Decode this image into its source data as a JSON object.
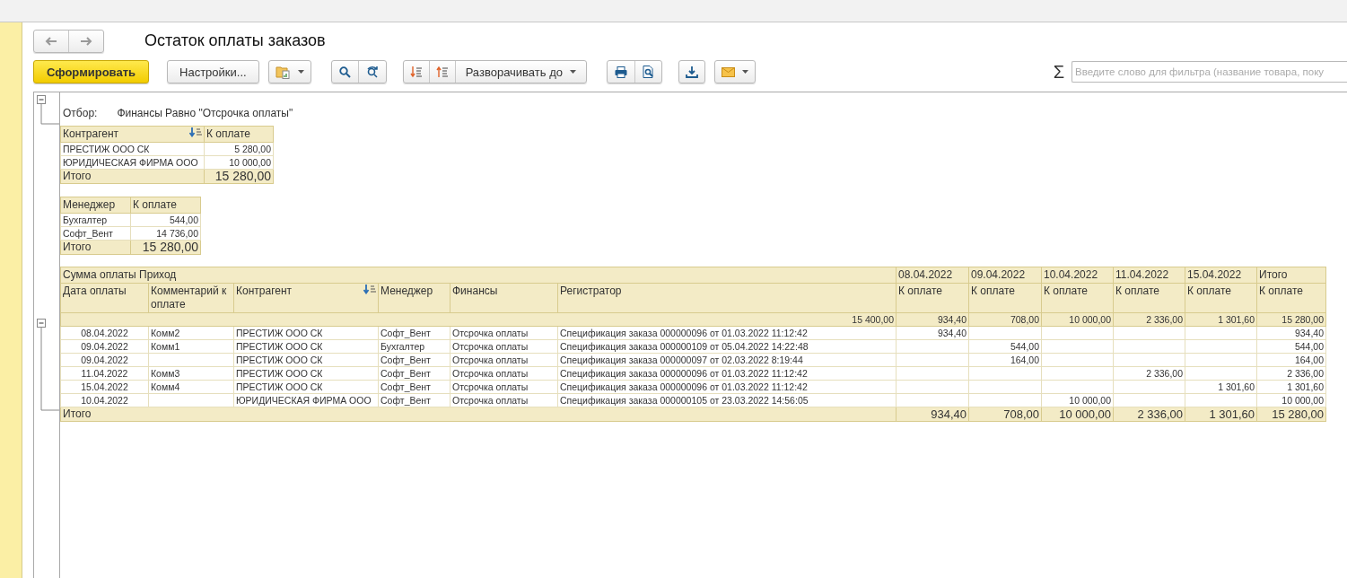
{
  "window": {
    "title": "Остаток оплаты заказов"
  },
  "navigation": [
    {
      "kind": "back",
      "disabled": true
    },
    {
      "kind": "forward",
      "disabled": true
    }
  ],
  "toolbar": [
    {
      "kind": "primary",
      "label": "Сформировать"
    },
    {
      "kind": "text",
      "label": "Настройки..."
    },
    {
      "kind": "variant-menu"
    },
    {
      "kind": "group",
      "items": [
        {
          "kind": "search"
        },
        {
          "kind": "search-refresh"
        }
      ]
    },
    {
      "kind": "group",
      "items": [
        {
          "kind": "sort-down"
        },
        {
          "kind": "sort-up"
        },
        {
          "kind": "dropdown",
          "label": "Разворачивать до"
        }
      ]
    },
    {
      "kind": "group",
      "items": [
        {
          "kind": "print"
        },
        {
          "kind": "preview"
        }
      ]
    },
    {
      "kind": "download"
    },
    {
      "kind": "mail-menu"
    }
  ],
  "sum_symbol": "Σ",
  "filter_field": {
    "placeholder": "Введите слово для фильтра (название товара, поку"
  },
  "report": {
    "filter": {
      "label": "Отбор:",
      "value": "Финансы Равно \"Отсрочка оплаты\""
    },
    "summary_tables": [
      {
        "columns": [
          {
            "label": "Контрагент",
            "sorted": true
          },
          {
            "label": "К оплате",
            "sorted": false
          }
        ],
        "rows": [
          [
            "ПРЕСТИЖ ООО СК",
            "5 280,00"
          ],
          [
            "ЮРИДИЧЕСКАЯ ФИРМА ООО",
            "10 000,00"
          ]
        ],
        "total": [
          "Итого",
          "15 280,00"
        ]
      },
      {
        "columns": [
          {
            "label": "Менеджер",
            "sorted": false
          },
          {
            "label": "К оплате",
            "sorted": false
          }
        ],
        "rows": [
          [
            "Бухгалтер",
            "544,00"
          ],
          [
            "Софт_Вент",
            "14 736,00"
          ]
        ],
        "total": [
          "Итого",
          "15 280,00"
        ]
      }
    ],
    "main_table": {
      "group_header": "Сумма оплаты Приход",
      "columns": [
        {
          "label": "Дата оплаты",
          "sorted": false
        },
        {
          "label": "Комментарий к оплате",
          "sorted": false
        },
        {
          "label": "Контрагент",
          "sorted": true
        },
        {
          "label": "Менеджер",
          "sorted": false
        },
        {
          "label": "Финансы",
          "sorted": false
        },
        {
          "label": "Регистратор",
          "sorted": false
        }
      ],
      "amount_columns": [
        {
          "period": "08.04.2022",
          "label": "К оплате"
        },
        {
          "period": "09.04.2022",
          "label": "К оплате"
        },
        {
          "period": "10.04.2022",
          "label": "К оплате"
        },
        {
          "period": "11.04.2022",
          "label": "К оплате"
        },
        {
          "period": "15.04.2022",
          "label": "К оплате"
        },
        {
          "period": "Итого",
          "label": "К оплате"
        }
      ],
      "group_row": {
        "amount": "15 400,00",
        "amounts": [
          "934,40",
          "708,00",
          "10 000,00",
          "2 336,00",
          "1 301,60",
          "15 280,00"
        ]
      },
      "rows": [
        {
          "date": "08.04.2022",
          "comment": "Комм2",
          "counterparty": "ПРЕСТИЖ ООО СК",
          "manager": "Софт_Вент",
          "finance": "Отсрочка оплаты",
          "registrar": "Спецификация заказа 000000096 от 01.03.2022 11:12:42",
          "amounts": {
            "column_1": "934,40"
          },
          "total": "934,40"
        },
        {
          "date": "09.04.2022",
          "comment": "Комм1",
          "counterparty": "ПРЕСТИЖ ООО СК",
          "manager": "Бухгалтер",
          "finance": "Отсрочка оплаты",
          "registrar": "Спецификация заказа 000000109 от 05.04.2022 14:22:48",
          "amounts": {
            "column_2": "544,00"
          },
          "total": "544,00"
        },
        {
          "date": "09.04.2022",
          "counterparty": "ПРЕСТИЖ ООО СК",
          "manager": "Софт_Вент",
          "finance": "Отсрочка оплаты",
          "registrar": "Спецификация заказа 000000097 от 02.03.2022 8:19:44",
          "amounts": {
            "column_2": "164,00"
          },
          "total": "164,00"
        },
        {
          "date": "11.04.2022",
          "comment": "Комм3",
          "counterparty": "ПРЕСТИЖ ООО СК",
          "manager": "Софт_Вент",
          "finance": "Отсрочка оплаты",
          "registrar": "Спецификация заказа 000000096 от 01.03.2022 11:12:42",
          "amounts": {
            "column_4": "2 336,00"
          },
          "total": "2 336,00"
        },
        {
          "date": "15.04.2022",
          "comment": "Комм4",
          "counterparty": "ПРЕСТИЖ ООО СК",
          "manager": "Софт_Вент",
          "finance": "Отсрочка оплаты",
          "registrar": "Спецификация заказа 000000096 от 01.03.2022 11:12:42",
          "amounts": {
            "column_5": "1 301,60"
          },
          "total": "1 301,60"
        },
        {
          "date": "10.04.2022",
          "counterparty": "ЮРИДИЧЕСКАЯ ФИРМА ООО",
          "manager": "Софт_Вент",
          "finance": "Отсрочка оплаты",
          "registrar": "Спецификация заказа 000000105 от 23.03.2022 14:56:05",
          "amounts": {
            "column_3": "10 000,00"
          },
          "total": "10 000,00"
        }
      ],
      "total": {
        "label": "Итого",
        "amounts": [
          "934,40",
          "708,00",
          "10 000,00",
          "2 336,00",
          "1 301,60",
          "15 280,00"
        ]
      }
    }
  }
}
